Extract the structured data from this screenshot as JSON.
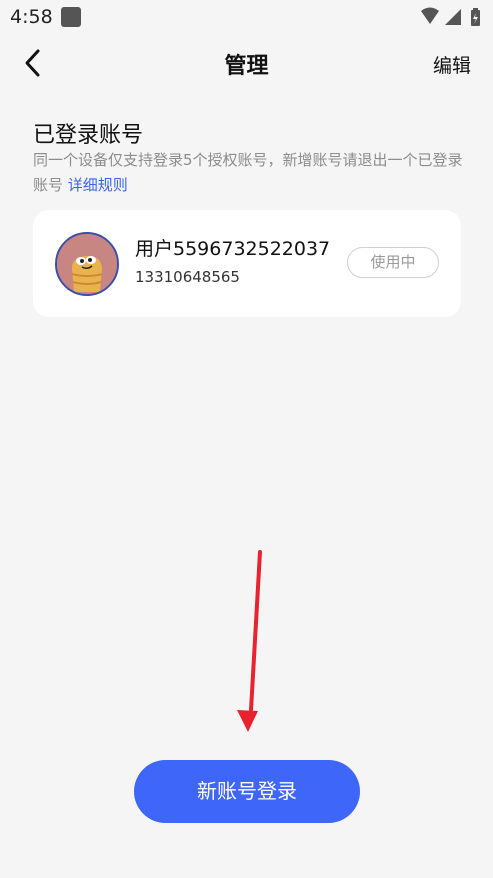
{
  "status_bar": {
    "time": "4:58",
    "icons": [
      "app-icon",
      "wifi-icon",
      "signal-icon",
      "battery-icon"
    ]
  },
  "nav": {
    "title": "管理",
    "edit_label": "编辑",
    "back_icon": "chevron-left-icon"
  },
  "section": {
    "title": "已登录账号",
    "description": "同一个设备仅支持登录5个授权账号，新增账号请退出一个已登录账号",
    "rules_link": "详细规则"
  },
  "account": {
    "username": "用户5596732522037",
    "phone": "13310648565",
    "status": "使用中"
  },
  "footer": {
    "new_login_label": "新账号登录"
  },
  "colors": {
    "accent": "#3e66f8",
    "link": "#3d63e8",
    "annotation": "#e8232f",
    "background": "#f5f5f5"
  }
}
